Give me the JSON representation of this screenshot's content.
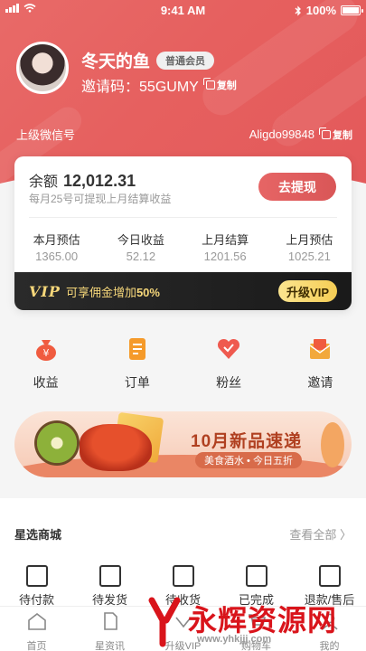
{
  "status_bar": {
    "time": "9:41 AM",
    "battery": "100%",
    "battery_level": 1.0
  },
  "profile": {
    "name": "冬天的鱼",
    "member_badge": "普通会员",
    "invite_label": "邀请码：",
    "invite_code": "55GUMY",
    "copy_label": "复制"
  },
  "wechat": {
    "label": "上级微信号",
    "value": "Aligdo99848",
    "copy_label": "复制"
  },
  "balance": {
    "label": "余额",
    "value": "12,012.31",
    "note": "每月25号可提现上月结算收益",
    "withdraw_label": "去提现"
  },
  "stats": [
    {
      "label": "本月预估",
      "value": "1365.00"
    },
    {
      "label": "今日收益",
      "value": "52.12"
    },
    {
      "label": "上月结算",
      "value": "1201.56"
    },
    {
      "label": "上月预估",
      "value": "1025.21"
    }
  ],
  "vip": {
    "logo": "VIP",
    "text": "可享佣金增加",
    "percent": "50%",
    "button": "升级VIP"
  },
  "quick_actions": [
    {
      "label": "收益",
      "icon": "money-bag-icon",
      "color": "#f05b3f"
    },
    {
      "label": "订单",
      "icon": "order-doc-icon",
      "color": "#f59a2a"
    },
    {
      "label": "粉丝",
      "icon": "heart-fans-icon",
      "color": "#ef5a4f"
    },
    {
      "label": "邀请",
      "icon": "invite-envelope-icon",
      "color": "#f2a93b"
    }
  ],
  "banner": {
    "title": "10月新品速递",
    "subtitle": "美食酒水 • 今日五折"
  },
  "mall": {
    "title": "星选商城",
    "more": "查看全部 〉",
    "orders": [
      {
        "label": "待付款",
        "icon": "wallet-icon"
      },
      {
        "label": "待发货",
        "icon": "package-icon"
      },
      {
        "label": "待收货",
        "icon": "truck-icon"
      },
      {
        "label": "已完成",
        "icon": "checklist-icon"
      },
      {
        "label": "退款/售后",
        "icon": "refund-icon"
      }
    ]
  },
  "tabbar": [
    {
      "label": "首页",
      "icon": "home-icon"
    },
    {
      "label": "星资讯",
      "icon": "news-icon"
    },
    {
      "label": "升级VIP",
      "icon": "vip-icon"
    },
    {
      "label": "购物车",
      "icon": "cart-icon"
    },
    {
      "label": "我的",
      "icon": "profile-icon"
    }
  ],
  "watermark": {
    "text": "永辉资源网",
    "url": "www.yhkjjj.com"
  },
  "colors": {
    "brand_red": "#e6605f",
    "vip_gold": "#f6d77a",
    "vip_dark": "#1f1f1f"
  }
}
